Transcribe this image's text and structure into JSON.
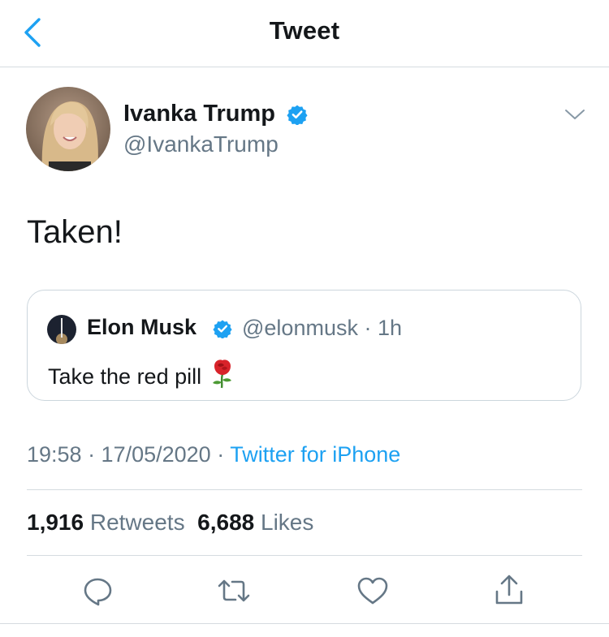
{
  "header": {
    "title": "Tweet",
    "back_icon": "chevron-left-icon",
    "accent": "#1da1f2"
  },
  "tweet": {
    "author_name": "Ivanka Trump",
    "author_handle": "@IvankaTrump",
    "verified": true,
    "text": "Taken!",
    "timestamp": "19:58 · 17/05/2020 · ",
    "source": "Twitter for iPhone"
  },
  "quoted_tweet": {
    "author_name": "Elon Musk",
    "author_handle": "@elonmusk",
    "age": "1h",
    "verified": true,
    "text": "Take the red pill"
  },
  "stats": {
    "retweets_count": "1,916",
    "retweets_label": "Retweets",
    "likes_count": "6,688",
    "likes_label": "Likes"
  },
  "actions": [
    "reply-icon",
    "retweet-icon",
    "like-icon",
    "share-icon"
  ],
  "colors": {
    "text": "#14171a",
    "secondary": "#657786",
    "link": "#1da1f2",
    "divider": "#d5dbe0"
  }
}
